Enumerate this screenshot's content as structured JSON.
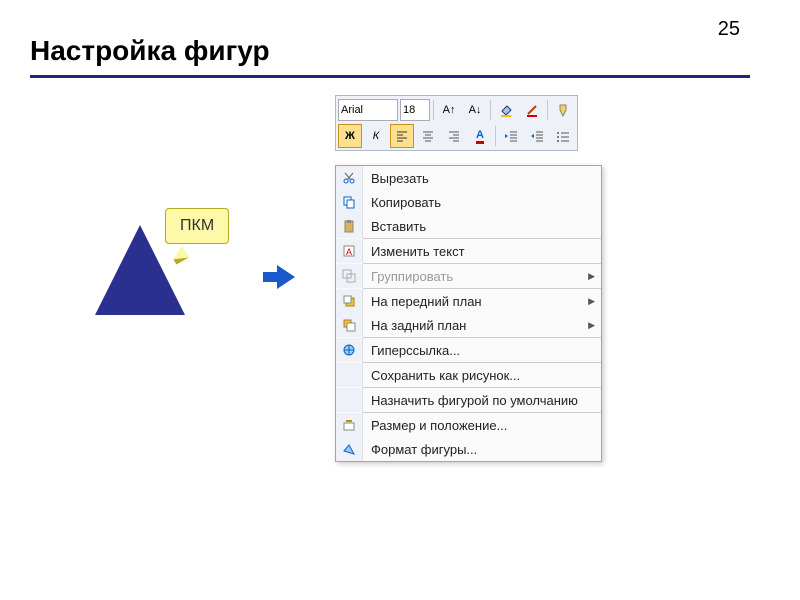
{
  "page_number": "25",
  "title": "Настройка фигур",
  "callout": "ПКМ",
  "toolbar": {
    "font_name": "Arial",
    "font_size": "18",
    "bold": "Ж",
    "italic": "К"
  },
  "menu": {
    "cut": "Вырезать",
    "copy": "Копировать",
    "paste": "Вставить",
    "edit_text": "Изменить текст",
    "group": "Группировать",
    "bring_front": "На передний план",
    "send_back": "На задний план",
    "hyperlink": "Гиперссылка...",
    "save_pic": "Сохранить как рисунок...",
    "set_default": "Назначить фигурой по умолчанию",
    "size_pos": "Размер и положение...",
    "format": "Формат фигуры..."
  }
}
